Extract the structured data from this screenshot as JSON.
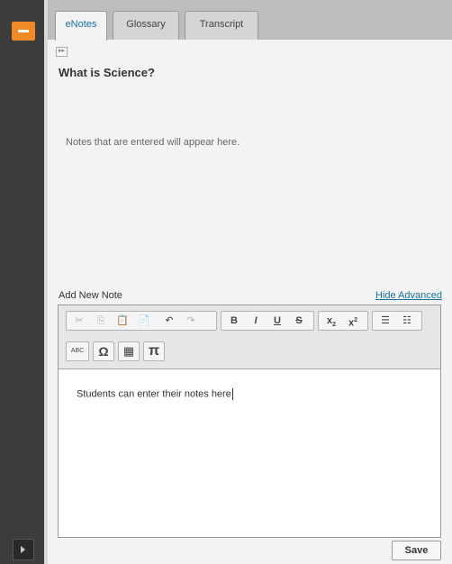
{
  "tabs": [
    {
      "label": "eNotes",
      "active": true
    },
    {
      "label": "Glossary",
      "active": false
    },
    {
      "label": "Transcript",
      "active": false
    }
  ],
  "page_title": "What is Science?",
  "notes_placeholder": "Notes that are entered will appear here.",
  "add_note": {
    "label": "Add New Note",
    "toggle_advanced": "Hide Advanced"
  },
  "editor": {
    "text": "Students can enter their notes here",
    "toolbar": {
      "bold": "B",
      "italic": "I",
      "underline": "U",
      "strike": "S",
      "spellcheck": "ABC",
      "special_char": "Ω",
      "pi": "π"
    }
  },
  "save_label": "Save",
  "colors": {
    "accent": "#f08a24",
    "link": "#1a6fa0",
    "sidebar": "#3c3c3c"
  }
}
